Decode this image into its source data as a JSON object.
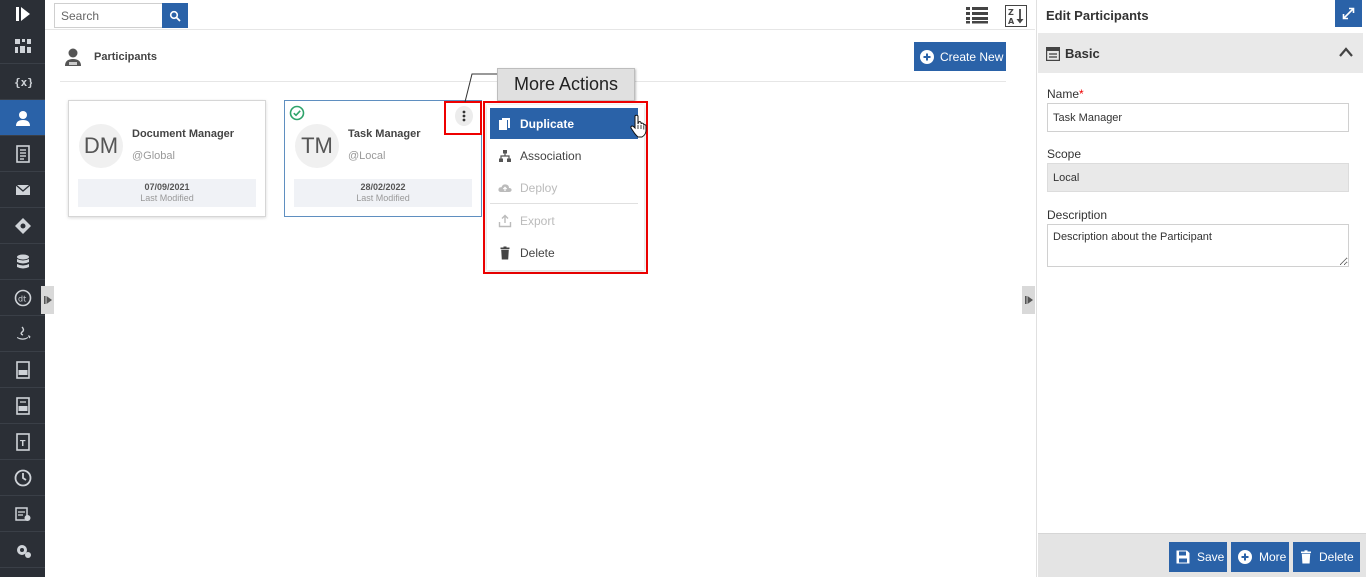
{
  "topbar": {
    "search_placeholder": "Search"
  },
  "page": {
    "title": "Participants",
    "create_new_label": "Create New"
  },
  "cards": [
    {
      "initials": "DM",
      "name": "Document Manager",
      "scope": "@Global",
      "date": "07/09/2021",
      "modified_label": "Last Modified"
    },
    {
      "initials": "TM",
      "name": "Task Manager",
      "scope": "@Local",
      "date": "28/02/2022",
      "modified_label": "Last Modified"
    }
  ],
  "callout": {
    "label": "More Actions"
  },
  "menu": {
    "items": [
      {
        "label": "Duplicate",
        "icon": "duplicate-icon",
        "state": "highlighted"
      },
      {
        "label": "Association",
        "icon": "association-icon",
        "state": "enabled"
      },
      {
        "label": "Deploy",
        "icon": "cloud-upload-icon",
        "state": "disabled"
      },
      {
        "label": "Export",
        "icon": "export-icon",
        "state": "disabled"
      },
      {
        "label": "Delete",
        "icon": "trash-icon",
        "state": "enabled"
      }
    ]
  },
  "panel": {
    "title": "Edit Participants",
    "section_title": "Basic",
    "name_label": "Name",
    "required_mark": "*",
    "name_value": "Task Manager",
    "scope_label": "Scope",
    "scope_value": "Local",
    "description_label": "Description",
    "description_value": "Description about the Participant",
    "save_label": "Save",
    "more_label": "More",
    "delete_label": "Delete"
  },
  "colors": {
    "accent": "#2a62a8",
    "nav_bg": "#2b2f36",
    "highlight_red": "#e00000",
    "success_green": "#2ea36a"
  }
}
